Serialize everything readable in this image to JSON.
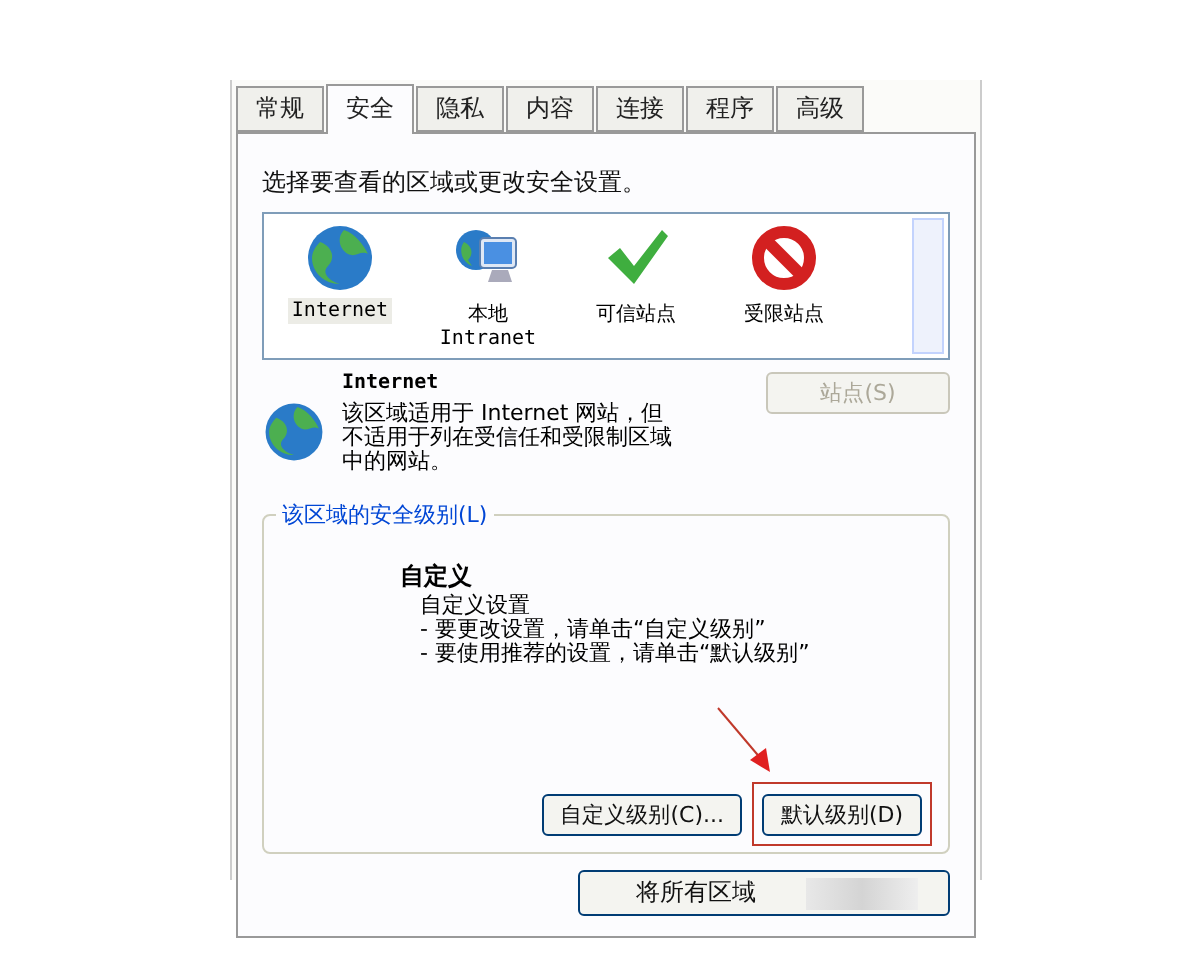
{
  "tabs": [
    {
      "label": "常规",
      "selected": false
    },
    {
      "label": "安全",
      "selected": true
    },
    {
      "label": "隐私",
      "selected": false
    },
    {
      "label": "内容",
      "selected": false
    },
    {
      "label": "连接",
      "selected": false
    },
    {
      "label": "程序",
      "selected": false
    },
    {
      "label": "高级",
      "selected": false
    }
  ],
  "instruction": "选择要查看的区域或更改安全设置。",
  "zones": [
    {
      "kind": "globe",
      "label": "Internet",
      "selected": true
    },
    {
      "kind": "computer",
      "label": "本地\nIntranet",
      "selected": false
    },
    {
      "kind": "check",
      "label": "可信站点",
      "selected": false
    },
    {
      "kind": "blocked",
      "label": "受限站点",
      "selected": false
    }
  ],
  "zone_info": {
    "title": "Internet",
    "description": [
      "该区域适用于 Internet 网站，但",
      "不适用于列在受信任和受限制区域",
      "中的网站。"
    ],
    "sites_button": {
      "label": "站点(S)",
      "disabled": true
    }
  },
  "security_level": {
    "group_label": "该区域的安全级别(L)",
    "name": "自定义",
    "lines": [
      "自定义设置",
      "- 要更改设置，请单击“自定义级别”",
      "- 要使用推荐的设置，请单击“默认级别”"
    ],
    "buttons": [
      {
        "label": "自定义级别(C)...",
        "highlighted": false
      },
      {
        "label": "默认级别(D)",
        "highlighted": true
      }
    ]
  },
  "reset_button": {
    "label": "将所有区域"
  }
}
